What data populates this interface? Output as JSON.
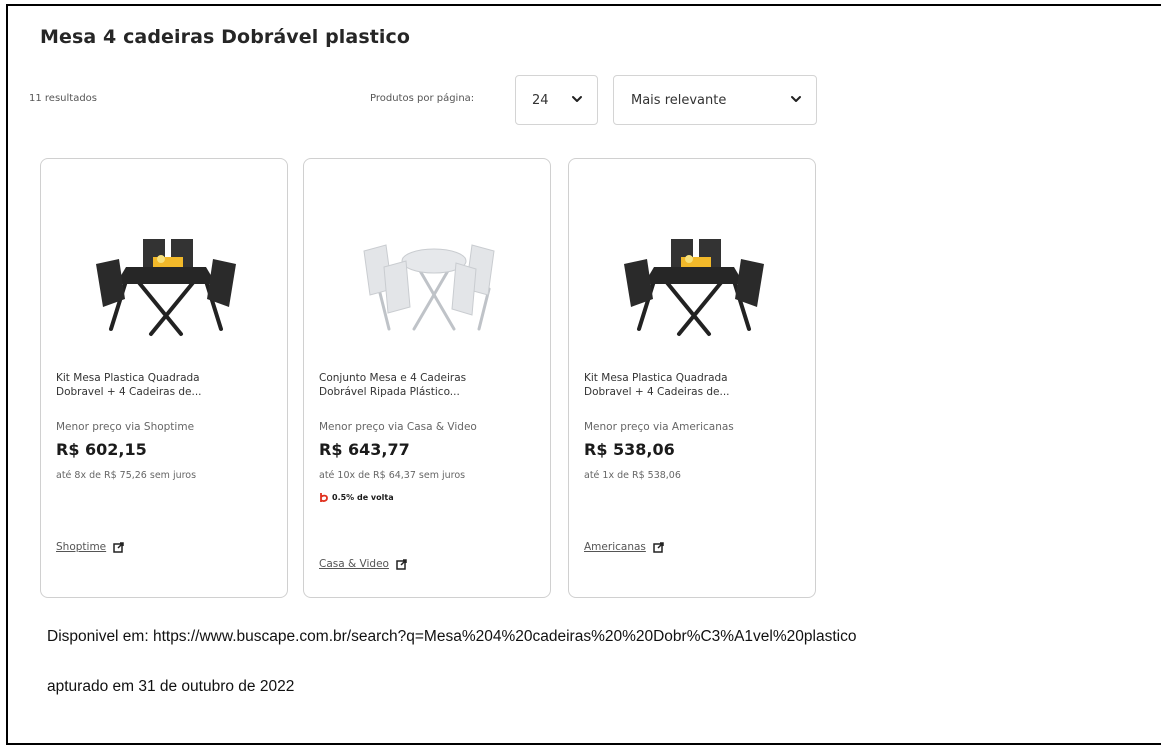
{
  "page": {
    "title": "Mesa 4 cadeiras Dobrável plastico"
  },
  "toolbar": {
    "results": "11 resultados",
    "per_page_label": "Produtos por página:",
    "per_page_value": "24",
    "sort_value": "Mais relevante"
  },
  "products": [
    {
      "name_line1": "Kit Mesa Plastica Quadrada",
      "name_line2": "Dobravel + 4 Cadeiras de...",
      "via": "Menor preço via Shoptime",
      "price": "R$ 602,15",
      "installments": "até 8x de R$ 75,26 sem juros",
      "store": "Shoptime",
      "image_icon": "black-folding-table-set-image"
    },
    {
      "name_line1": "Conjunto Mesa e 4 Cadeiras",
      "name_line2": "Dobrável Ripada Plástico...",
      "via": "Menor preço via Casa & Video",
      "price": "R$ 643,77",
      "installments": "até 10x de R$ 64,37 sem juros",
      "cashback": "0.5% de volta",
      "store": "Casa & Video",
      "image_icon": "white-folding-table-set-image"
    },
    {
      "name_line1": "Kit Mesa Plastica Quadrada",
      "name_line2": "Dobravel + 4 Cadeiras de...",
      "via": "Menor preço via Americanas",
      "price": "R$ 538,06",
      "installments": "até 1x de R$ 538,06",
      "store": "Americanas",
      "image_icon": "black-folding-table-set-image"
    }
  ],
  "footer": {
    "source": "Disponivel em: https://www.buscape.com.br/search?q=Mesa%204%20cadeiras%20%20Dobr%C3%A1vel%20plastico",
    "captured": "apturado em 31 de outubro de 2022"
  },
  "colors": {
    "card_border": "#d0d0d0",
    "text": "#1b1b1b",
    "muted": "#666666"
  }
}
